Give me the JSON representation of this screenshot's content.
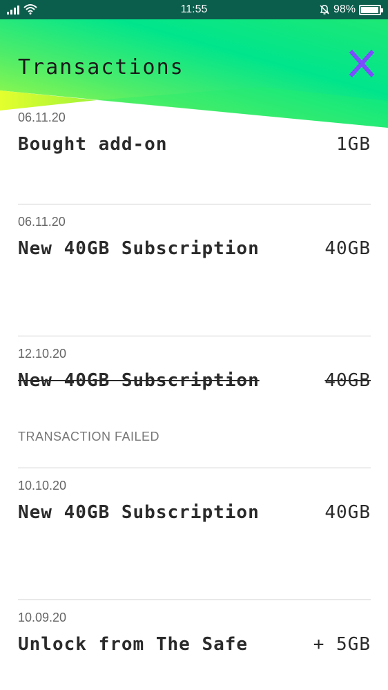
{
  "status_bar": {
    "time": "11:55",
    "battery": "98%"
  },
  "header": {
    "title": "Transactions",
    "colors": {
      "green": "#00e58c",
      "lime": "#c8ff2e",
      "close": "#7b4dff"
    }
  },
  "transactions": [
    {
      "date": "06.11.20",
      "title": "Bought add-on",
      "amount": "1GB",
      "failed": false,
      "status": ""
    },
    {
      "date": "06.11.20",
      "title": "New 40GB Subscription",
      "amount": "40GB",
      "failed": false,
      "status": ""
    },
    {
      "date": "12.10.20",
      "title": "New 40GB Subscription",
      "amount": "40GB",
      "failed": true,
      "status": "TRANSACTION FAILED"
    },
    {
      "date": "10.10.20",
      "title": "New 40GB Subscription",
      "amount": "40GB",
      "failed": false,
      "status": ""
    },
    {
      "date": "10.09.20",
      "title": "Unlock from The Safe",
      "amount": "+ 5GB",
      "failed": false,
      "status": ""
    }
  ]
}
